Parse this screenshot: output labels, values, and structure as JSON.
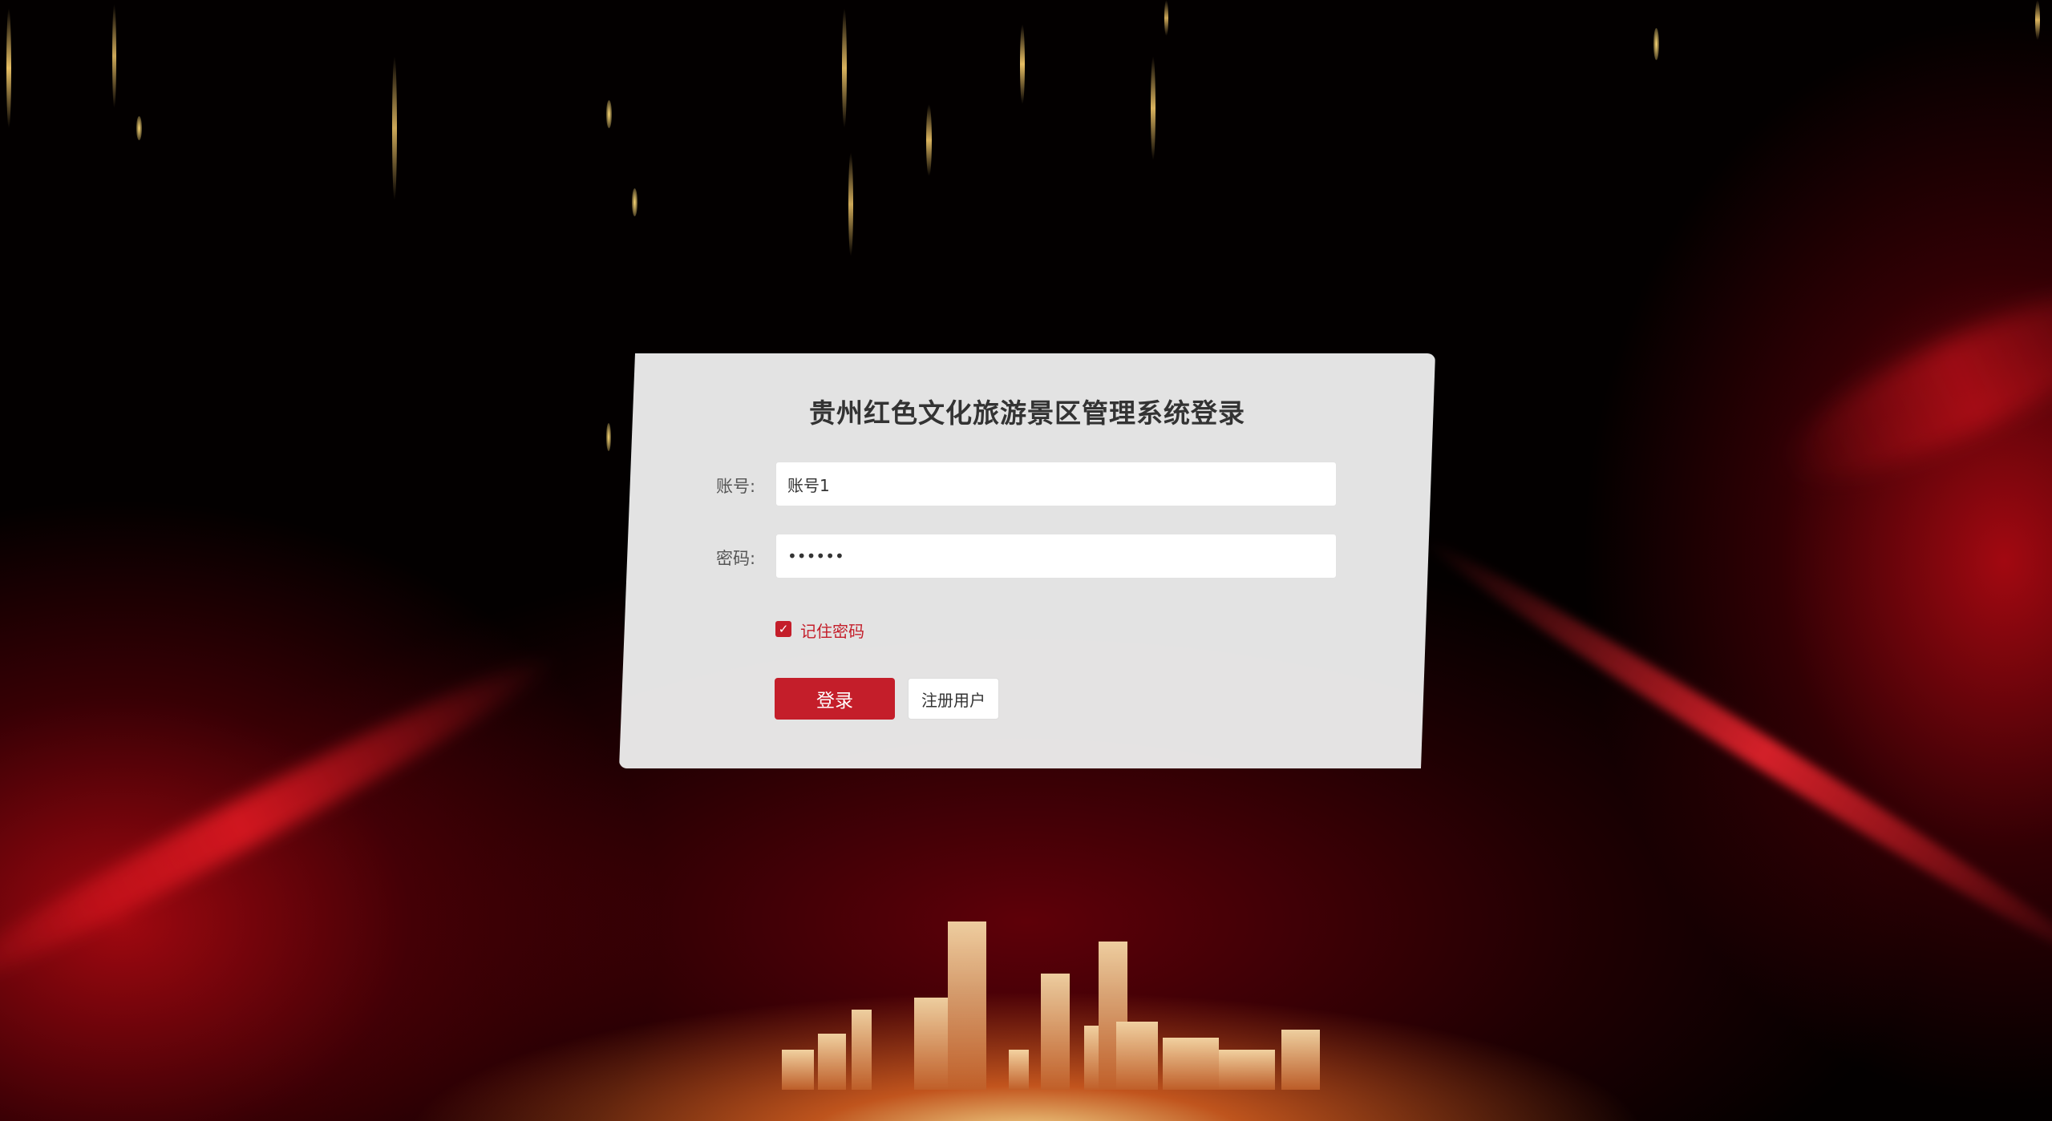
{
  "login": {
    "title": "贵州红色文化旅游景区管理系统登录",
    "account_label": "账号:",
    "account_value": "账号1",
    "password_label": "密码:",
    "password_value": "••••••",
    "remember_label": "记住密码",
    "remember_checked": true,
    "login_button": "登录",
    "register_button": "注册用户"
  },
  "colors": {
    "accent": "#c41e2a",
    "card_bg": "#ececec",
    "background": "#030000"
  }
}
